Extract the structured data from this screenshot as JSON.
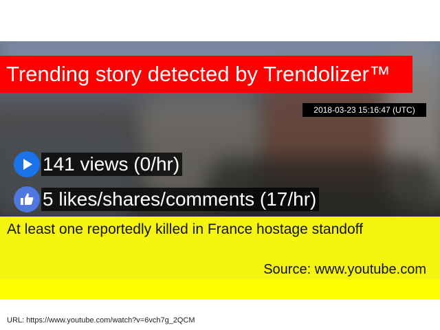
{
  "banner": {
    "title": "Trending story detected by Trendolizer™"
  },
  "timestamp": "2018-03-23 15:16:47 (UTC)",
  "stats": {
    "views": {
      "icon": "play-icon",
      "text": "141 views (0/hr)"
    },
    "engagement": {
      "icon": "thumbs-up-icon",
      "text": "5 likes/shares/comments (17/hr)"
    }
  },
  "story": {
    "headline": "At least one reportedly killed in France hostage standoff",
    "source": "Source: www.youtube.com"
  },
  "footer": {
    "url": "URL: https://www.youtube.com/watch?v=6vch7g_2QCM"
  },
  "colors": {
    "banner_bg": "#ff0000",
    "headline_bg": "#f5f50f",
    "play_icon_bg": "#1a73e8",
    "like_icon_bg": "#4e78e0"
  }
}
